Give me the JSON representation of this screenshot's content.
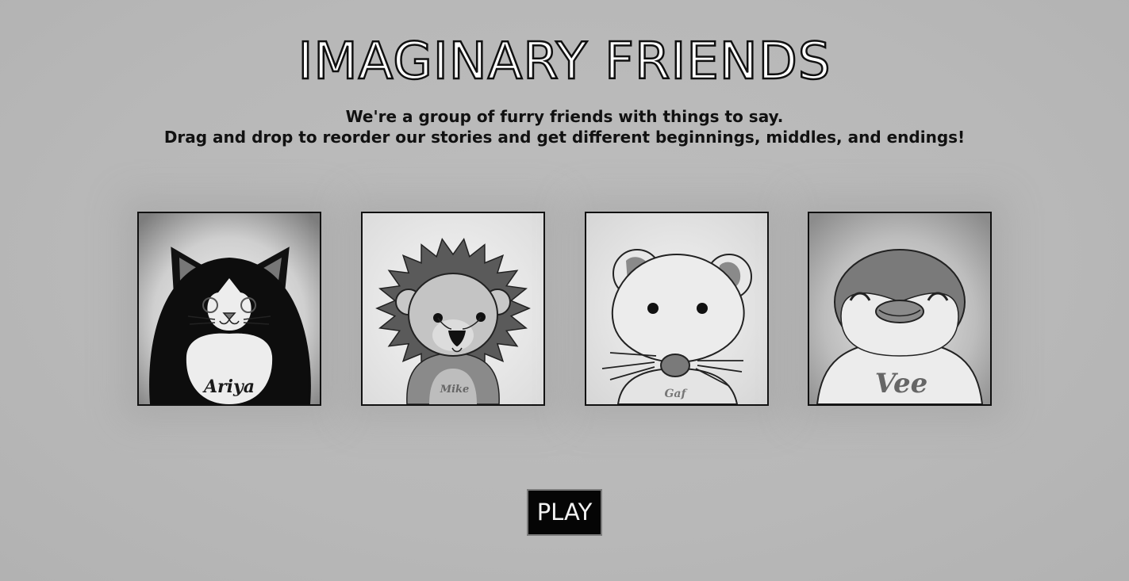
{
  "header": {
    "title": "IMAGINARY FRIENDS",
    "subtitle_line1": "We're a group of furry friends with things to say.",
    "subtitle_line2": "Drag and drop to reorder our stories and get different beginnings, middles, and endings!"
  },
  "friends": [
    {
      "name": "Ariya",
      "animal": "cat-icon"
    },
    {
      "name": "Mike",
      "animal": "lion-icon"
    },
    {
      "name": "Gaf",
      "animal": "mouse-icon"
    },
    {
      "name": "Vee",
      "animal": "penguin-icon"
    }
  ],
  "controls": {
    "play_label": "PLAY"
  },
  "colors": {
    "background": "#b9b9b9",
    "ink": "#111111",
    "button_bg": "#050505",
    "button_text": "#f2f2f2"
  }
}
